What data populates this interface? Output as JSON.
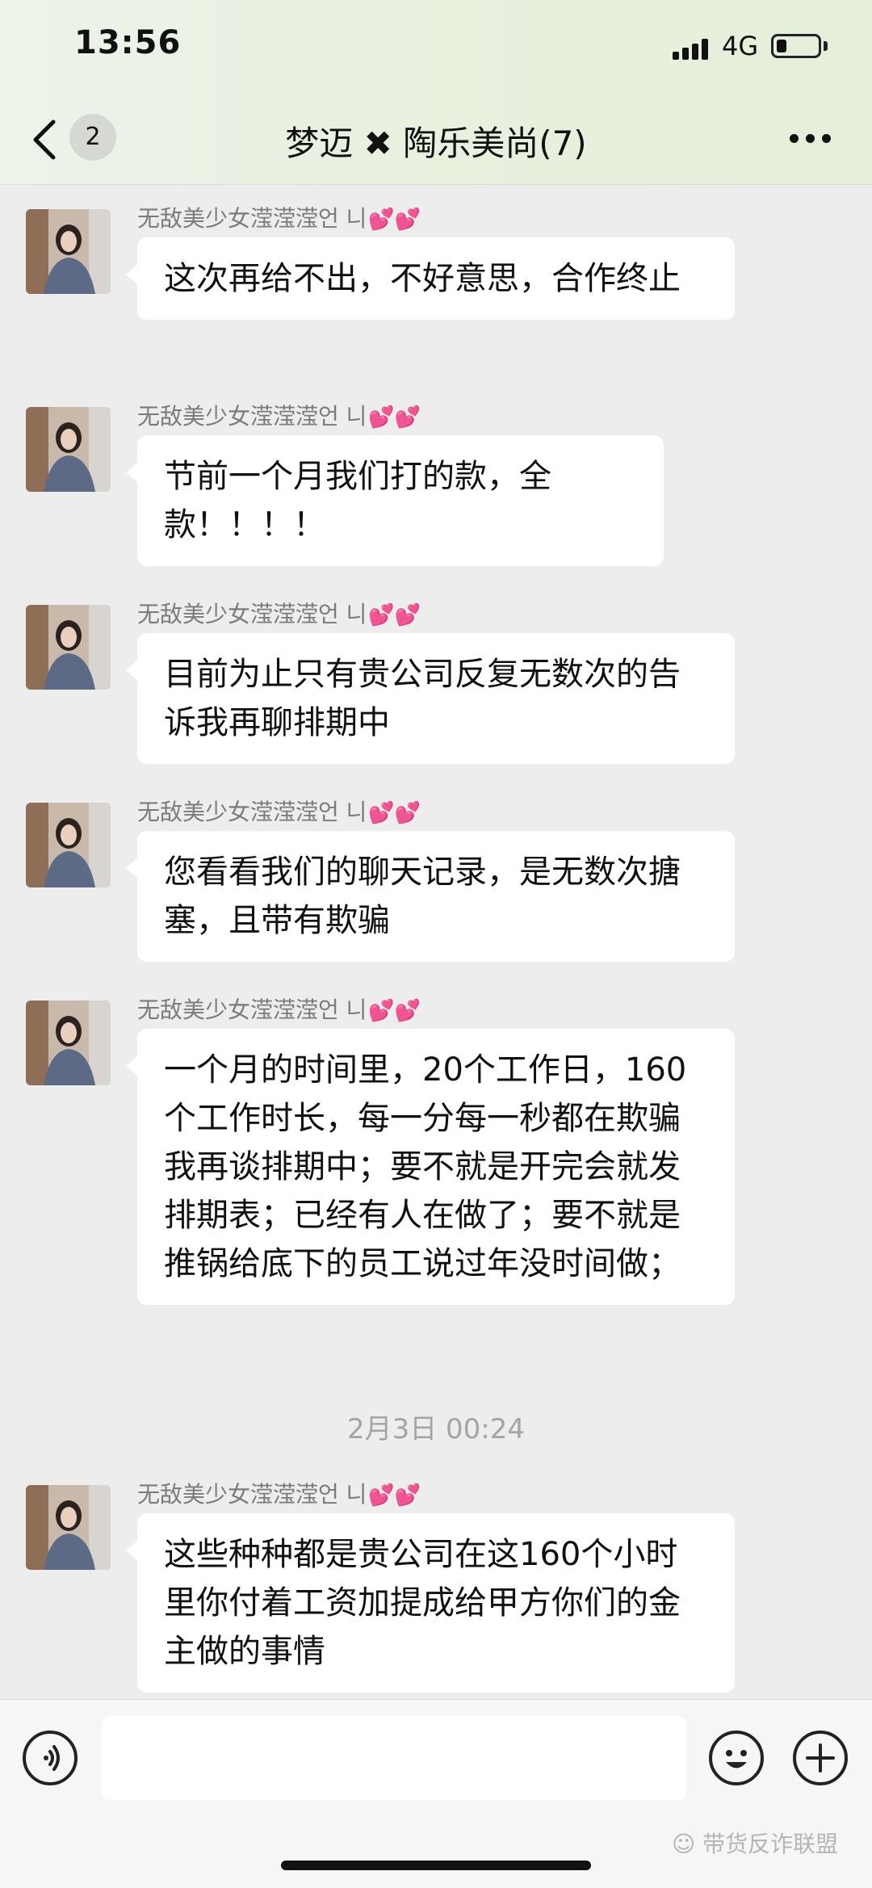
{
  "status_bar": {
    "time": "13:56",
    "network": "4G",
    "battery_level": 0.25
  },
  "header": {
    "unread_count": "2",
    "title": "梦迈 ✖ 陶乐美尚(7)",
    "icons": {
      "back": "chevron-left-icon",
      "more": "ellipsis-icon"
    }
  },
  "messages": [
    {
      "sender": "无敌美少女滢滢滢언 니",
      "hearts": "💕💕",
      "text": "这次再给不出，不好意思，合作终止"
    },
    {
      "sender": "无敌美少女滢滢滢언 니",
      "hearts": "💕💕",
      "text": "节前一个月我们打的款，全款！！！！"
    },
    {
      "sender": "无敌美少女滢滢滢언 니",
      "hearts": "💕💕",
      "text": "目前为止只有贵公司反复无数次的告诉我再聊排期中"
    },
    {
      "sender": "无敌美少女滢滢滢언 니",
      "hearts": "💕💕",
      "text": "您看看我们的聊天记录，是无数次搪塞，且带有欺骗"
    },
    {
      "sender": "无敌美少女滢滢滢언 니",
      "hearts": "💕💕",
      "text": "一个月的时间里，20个工作日，160个工作时长，每一分每一秒都在欺骗我再谈排期中；要不就是开完会就发排期表；已经有人在做了；要不就是推锅给底下的员工说过年没时间做；"
    },
    {
      "sender": "无敌美少女滢滢滢언 니",
      "hearts": "💕💕",
      "text": "这些种种都是贵公司在这160个小时里你付着工资加提成给甲方你们的金主做的事情"
    }
  ],
  "timestamp": "2月3日 00:24",
  "input_bar": {
    "value": "",
    "icons": {
      "voice": "voice-icon",
      "emoji": "emoji-icon",
      "plus": "plus-icon"
    }
  },
  "watermark": "带货反诈联盟"
}
